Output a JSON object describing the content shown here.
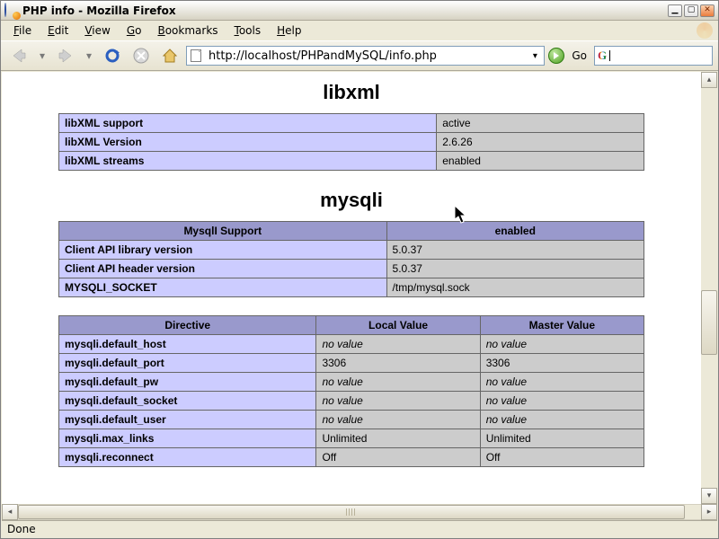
{
  "window": {
    "title": "PHP info - Mozilla Firefox"
  },
  "menu": {
    "file": "File",
    "edit": "Edit",
    "view": "View",
    "go": "Go",
    "bookmarks": "Bookmarks",
    "tools": "Tools",
    "help": "Help"
  },
  "toolbar": {
    "url": "http://localhost/PHPandMySQL/info.php",
    "go_label": "Go"
  },
  "status": {
    "text": "Done"
  },
  "sections": {
    "libxml": {
      "heading": "libxml",
      "rows": [
        {
          "k": "libXML support",
          "v": "active"
        },
        {
          "k": "libXML Version",
          "v": "2.6.26"
        },
        {
          "k": "libXML streams",
          "v": "enabled"
        }
      ]
    },
    "mysqli": {
      "heading": "mysqli",
      "support": {
        "head": [
          "MysqlI Support",
          "enabled"
        ],
        "rows": [
          {
            "k": "Client API library version",
            "v": "5.0.37"
          },
          {
            "k": "Client API header version",
            "v": "5.0.37"
          },
          {
            "k": "MYSQLI_SOCKET",
            "v": "/tmp/mysql.sock"
          }
        ]
      },
      "directives": {
        "head": [
          "Directive",
          "Local Value",
          "Master Value"
        ],
        "rows": [
          {
            "k": "mysqli.default_host",
            "lv": "no value",
            "mv": "no value",
            "lvnov": true,
            "mvnov": true
          },
          {
            "k": "mysqli.default_port",
            "lv": "3306",
            "mv": "3306"
          },
          {
            "k": "mysqli.default_pw",
            "lv": "no value",
            "mv": "no value",
            "lvnov": true,
            "mvnov": true
          },
          {
            "k": "mysqli.default_socket",
            "lv": "no value",
            "mv": "no value",
            "lvnov": true,
            "mvnov": true
          },
          {
            "k": "mysqli.default_user",
            "lv": "no value",
            "mv": "no value",
            "lvnov": true,
            "mvnov": true
          },
          {
            "k": "mysqli.max_links",
            "lv": "Unlimited",
            "mv": "Unlimited"
          },
          {
            "k": "mysqli.reconnect",
            "lv": "Off",
            "mv": "Off"
          }
        ]
      }
    }
  }
}
